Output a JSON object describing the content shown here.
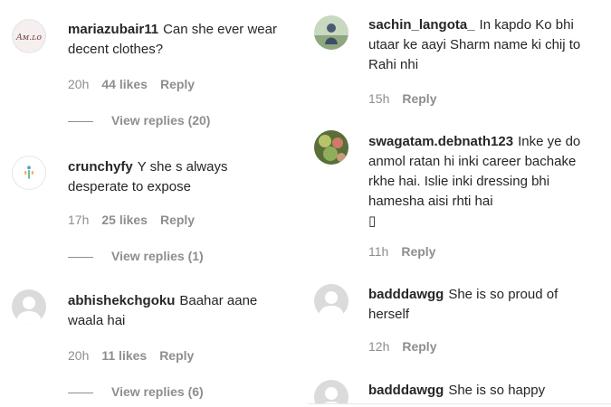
{
  "left_column": [
    {
      "username": "mariazubair11",
      "text": "Can she ever wear decent clothes?",
      "time": "20h",
      "likes": "44 likes",
      "reply": "Reply",
      "view_replies": "View replies (20)",
      "avatar": "logo-avatar"
    },
    {
      "username": "crunchyfy",
      "text": "Y she s always desperate to expose",
      "time": "17h",
      "likes": "25 likes",
      "reply": "Reply",
      "view_replies": "View replies (1)",
      "avatar": "logo-avatar"
    },
    {
      "username": "abhishekchgoku",
      "text": "Baahar aane waala hai",
      "time": "20h",
      "likes": "11 likes",
      "reply": "Reply",
      "view_replies": "View replies (6)",
      "avatar": "default-avatar"
    }
  ],
  "right_column": [
    {
      "username": "sachin_langota_",
      "text": "In kapdo Ko bhi utaar ke aayi Sharm name ki chij to Rahi nhi",
      "time": "15h",
      "reply": "Reply",
      "avatar": "photo-avatar"
    },
    {
      "username": "swagatam.debnath123",
      "text": "Inke ye do anmol ratan hi inki career bachake rkhe hai. Islie inki dressing bhi hamesha aisi rhti hai",
      "emoji_placeholder": "▯",
      "time": "11h",
      "reply": "Reply",
      "avatar": "photo-avatar"
    },
    {
      "username": "badddawgg",
      "text": "She is so proud of herself",
      "time": "12h",
      "reply": "Reply",
      "avatar": "default-avatar"
    },
    {
      "username": "badddawgg",
      "text": "She is so happy",
      "avatar": "default-avatar"
    }
  ],
  "colors": {
    "text": "#262626",
    "meta": "#8e8e8e",
    "avatar_default": "#dbdbdb"
  }
}
